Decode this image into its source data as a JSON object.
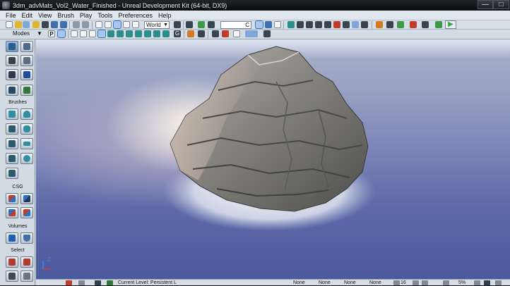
{
  "window": {
    "title": "3dm_advMats_Vol2_Water_Finished - Unreal Development Kit (64-bit, DX9)",
    "minimize": "—",
    "maximize": "□"
  },
  "menu": [
    "File",
    "Edit",
    "View",
    "Brush",
    "Play",
    "Tools",
    "Preferences",
    "Help"
  ],
  "toolbar": {
    "coordinate_system": "World",
    "search_value": "C",
    "play_icon": "▶"
  },
  "modes": {
    "label": "Modes",
    "arrow": "▼"
  },
  "sidebar": {
    "sections": [
      "Brushes",
      "CSG",
      "Volumes",
      "Select"
    ]
  },
  "viewport": {
    "axis_z": "Z",
    "axis_x": "X"
  },
  "status": {
    "current_level": "Current Level: Persistent L",
    "slot1": "None",
    "slot2": "None",
    "slot3": "None",
    "slot4": "None",
    "grid": "16",
    "zoom": "5%"
  },
  "colors": {
    "accent": "#3f6fb0",
    "play_green": "#2fa83a",
    "water_top": "#9aa2c4",
    "water_bottom": "#4b5a9e",
    "rock": "#7a7a78"
  }
}
